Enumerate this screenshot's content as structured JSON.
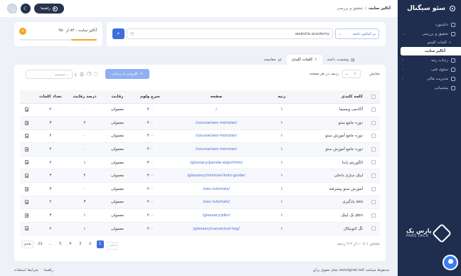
{
  "sidebar": {
    "brand": "سئو سیگنال",
    "items": [
      {
        "label": "داشبورد"
      },
      {
        "label": "تحقیق و بررسی"
      },
      {
        "label": "کلمات کلیدی"
      },
      {
        "label": "آنالیز سایت"
      },
      {
        "label": "ردیاب رتبه"
      },
      {
        "label": "سئوی فنی"
      },
      {
        "label": "مدیریت مالی"
      },
      {
        "label": "پشتیبانی"
      }
    ],
    "logo_text": "پارس پک",
    "logo_sub": "PARS PACK"
  },
  "topbar": {
    "guide_label": "راهنما",
    "breadcrumb_parent": "تحقیق و بررسی",
    "breadcrumb_current": "آنالیز سایت"
  },
  "search": {
    "url_value": "website.academy",
    "mode_label": "بر اساس دامنه"
  },
  "quota": {
    "label": "آنالیز سایت : ۸۲ از ۲۵۰",
    "fraction": 0.33
  },
  "tabs": [
    {
      "label": "وضعیت دامنه"
    },
    {
      "label": "کلمات کلیدی"
    },
    {
      "label": "مقایسه"
    }
  ],
  "toolbar": {
    "show_label": "نمایش",
    "rows_value": "۱۰",
    "rows_label": "ردیف در هر صفحه",
    "add_label": "افزودن به ردیاب",
    "search_placeholder": "جستجو..."
  },
  "table": {
    "headers": {
      "keyword": "کلمه کلیدی",
      "rank": "رتبه",
      "page": "صفحه",
      "volume": "سرچ ولوم",
      "competition": "رقابت",
      "competition_pct": "درصد رقابت",
      "keyword_count": "تعداد کلمات"
    },
    "rows": [
      {
        "keyword": "آکادمی وبسیما",
        "rank": "۱",
        "page": "/",
        "volume": "۴۰۰",
        "competition": "معمولی",
        "pct": "۰",
        "count": "۲"
      },
      {
        "keyword": "دوره جامع سئو",
        "rank": "۱",
        "page": "/course/seo-monster/",
        "volume": "۴۰۰",
        "competition": "معمولی",
        "pct": "۲",
        "count": "۳"
      },
      {
        "keyword": "دوره جامع آموزش سئو",
        "rank": "۱",
        "page": "/course/seo-monster/",
        "volume": "۴۰۰",
        "competition": "معمولی",
        "pct": "۰",
        "count": "۴"
      },
      {
        "keyword": "دوره جامع آموزش سئو",
        "rank": "۱",
        "page": "/course/seo-monster/",
        "volume": "۴۰۰",
        "competition": "معمولی",
        "pct": "۰",
        "count": "۴"
      },
      {
        "keyword": "الگوریتم پاندا",
        "rank": "۱",
        "page": "/glossary/panda-algorithm/",
        "volume": "۳۰۰",
        "competition": "معمولی",
        "pct": "۱",
        "count": "۲"
      },
      {
        "keyword": "لینک سازی داخلی",
        "rank": "۱",
        "page": "/glossary/internal-links-guide/",
        "volume": "۳۰۰",
        "competition": "معمولی",
        "pct": "۴",
        "count": "۳"
      },
      {
        "keyword": "آموزش سئو پیشرفته",
        "rank": "۱",
        "page": "/seo-tutorials/",
        "volume": "۲۰۰",
        "competition": "معمولی",
        "pct": "۰",
        "count": "۳"
      },
      {
        "keyword": "یادگیری seo",
        "rank": "۱",
        "page": "/seo-tutorials/",
        "volume": "۲۰۰",
        "competition": "معمولی",
        "pct": "۳",
        "count": "۲"
      },
      {
        "keyword": "بک لینک pbn",
        "rank": "۱",
        "page": "/glossary/pbn/",
        "volume": "۲۰۰",
        "competition": "معمولی",
        "pct": "۱",
        "count": "۳"
      },
      {
        "keyword": "تگ کنونیکال",
        "rank": "۱",
        "page": "/glossary/canonical-tag/",
        "volume": "۲۰۰",
        "competition": "معمولی",
        "pct": "۱",
        "count": "۲"
      }
    ]
  },
  "pagination": {
    "prev": "قبلی",
    "pages": [
      "1",
      "2",
      "3",
      "4",
      "5",
      "...",
      "22"
    ],
    "next": "بعدی",
    "showing": "نمایش ۱ تا ۱۰ از ۲۱۶ ردیف"
  },
  "footer": {
    "copyright": "تمام حقوق برای seosignal.net محفوظ میباشد",
    "terms": "شرایط استفاده",
    "guide": "راهنما"
  },
  "colors": {
    "sidebar": "#1f2d4e",
    "accent": "#3d6fdc",
    "quota": "#f5a623"
  }
}
